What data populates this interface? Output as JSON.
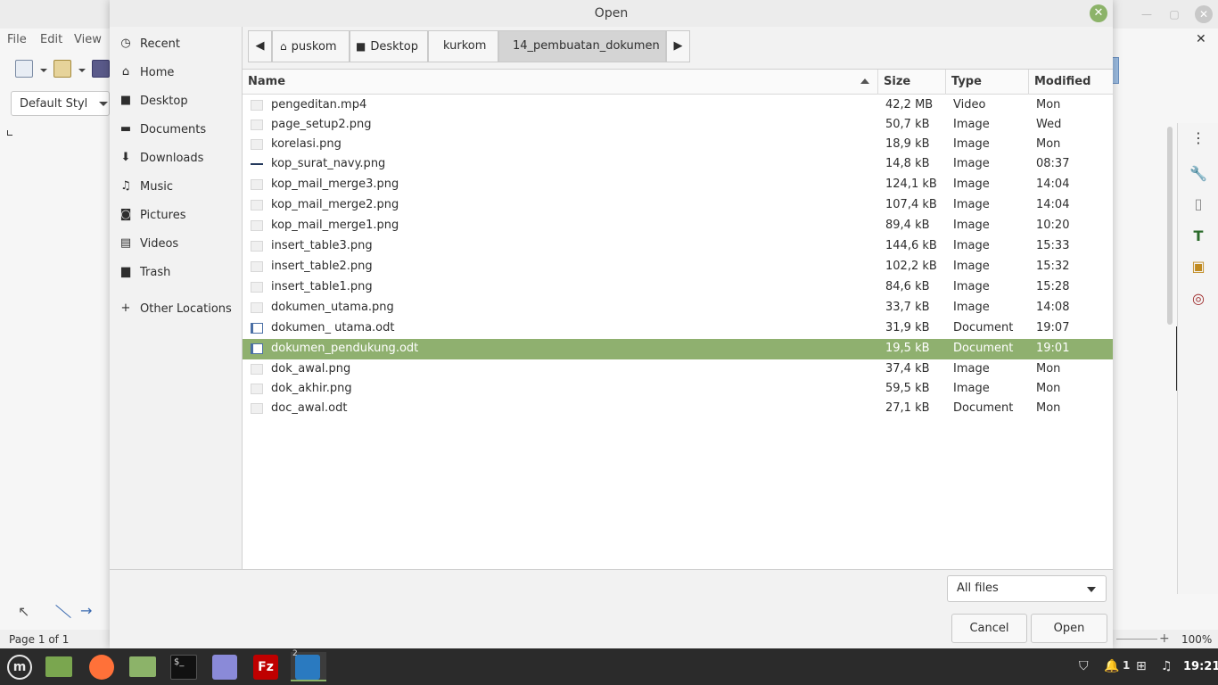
{
  "background_app": {
    "menu": [
      "File",
      "Edit",
      "View"
    ],
    "paragraph_style": "Default Styl",
    "status_page": "Page 1 of 1",
    "zoom": "100%"
  },
  "dialog": {
    "title": "Open",
    "places": [
      {
        "label": "Recent",
        "icon": "clock-icon"
      },
      {
        "label": "Home",
        "icon": "home-icon"
      },
      {
        "label": "Desktop",
        "icon": "desktop-icon"
      },
      {
        "label": "Documents",
        "icon": "documents-icon"
      },
      {
        "label": "Downloads",
        "icon": "download-icon"
      },
      {
        "label": "Music",
        "icon": "music-icon"
      },
      {
        "label": "Pictures",
        "icon": "camera-icon"
      },
      {
        "label": "Videos",
        "icon": "film-icon"
      },
      {
        "label": "Trash",
        "icon": "trash-icon"
      },
      {
        "label": "Other Locations",
        "icon": "plus-icon"
      }
    ],
    "path": [
      "puskom",
      "Desktop",
      "kurkom",
      "14_pembuatan_dokumen"
    ],
    "columns": {
      "name": "Name",
      "size": "Size",
      "type": "Type",
      "modified": "Modified"
    },
    "files": [
      {
        "name": "pengeditan.mp4",
        "size": "42,2 MB",
        "type": "Video",
        "modified": "Mon"
      },
      {
        "name": "page_setup2.png",
        "size": "50,7 kB",
        "type": "Image",
        "modified": "Wed"
      },
      {
        "name": "korelasi.png",
        "size": "18,9 kB",
        "type": "Image",
        "modified": "Mon"
      },
      {
        "name": "kop_surat_navy.png",
        "size": "14,8 kB",
        "type": "Image",
        "modified": "08:37"
      },
      {
        "name": "kop_mail_merge3.png",
        "size": "124,1 kB",
        "type": "Image",
        "modified": "14:04"
      },
      {
        "name": "kop_mail_merge2.png",
        "size": "107,4 kB",
        "type": "Image",
        "modified": "14:04"
      },
      {
        "name": "kop_mail_merge1.png",
        "size": "89,4 kB",
        "type": "Image",
        "modified": "10:20"
      },
      {
        "name": "insert_table3.png",
        "size": "144,6 kB",
        "type": "Image",
        "modified": "15:33"
      },
      {
        "name": "insert_table2.png",
        "size": "102,2 kB",
        "type": "Image",
        "modified": "15:32"
      },
      {
        "name": "insert_table1.png",
        "size": "84,6 kB",
        "type": "Image",
        "modified": "15:28"
      },
      {
        "name": "dokumen_utama.png",
        "size": "33,7 kB",
        "type": "Image",
        "modified": "14:08"
      },
      {
        "name": "dokumen_ utama.odt",
        "size": "31,9 kB",
        "type": "Document",
        "modified": "19:07"
      },
      {
        "name": "dokumen_pendukung.odt",
        "size": "19,5 kB",
        "type": "Document",
        "modified": "19:01",
        "selected": true
      },
      {
        "name": "dok_awal.png",
        "size": "37,4 kB",
        "type": "Image",
        "modified": "Mon"
      },
      {
        "name": "dok_akhir.png",
        "size": "59,5 kB",
        "type": "Image",
        "modified": "Mon"
      },
      {
        "name": "doc_awal.odt",
        "size": "27,1 kB",
        "type": "Document",
        "modified": "Mon"
      }
    ],
    "filter": "All files",
    "cancel_label": "Cancel",
    "open_label": "Open",
    "selection_color": "#8fb06f"
  },
  "taskbar": {
    "workspace_badge": "2",
    "notif_count": "1",
    "time": "19:21"
  }
}
